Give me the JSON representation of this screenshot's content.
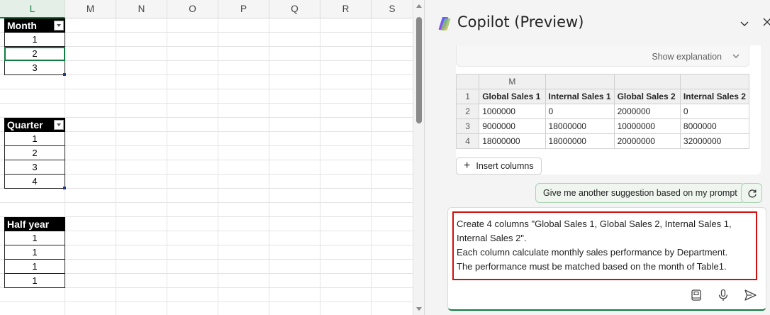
{
  "sheet": {
    "columns": [
      "L",
      "M",
      "N",
      "O",
      "P",
      "Q",
      "R",
      "S"
    ],
    "selected_column": "L",
    "tables": [
      {
        "header": "Month",
        "has_filter": true,
        "values": [
          "1",
          "2",
          "3"
        ]
      },
      {
        "header": "Quarter",
        "has_filter": true,
        "values": [
          "1",
          "2",
          "3",
          "4"
        ]
      },
      {
        "header": "Half year",
        "has_filter": false,
        "values": [
          "1",
          "1",
          "1",
          "1"
        ]
      }
    ]
  },
  "copilot": {
    "title": "Copilot (Preview)",
    "show_explanation": "Show explanation",
    "preview_table": {
      "column_letter": "M",
      "row_numbers": [
        "1",
        "2",
        "3",
        "4"
      ],
      "headers": [
        "Global Sales 1",
        "Internal Sales 1",
        "Global Sales 2",
        "Internal Sales 2"
      ],
      "rows": [
        [
          "1000000",
          "0",
          "2000000",
          "0"
        ],
        [
          "9000000",
          "18000000",
          "10000000",
          "8000000"
        ],
        [
          "18000000",
          "18000000",
          "20000000",
          "32000000"
        ]
      ]
    },
    "insert_columns": "Insert columns",
    "suggestion": "Give me another suggestion based on my prompt",
    "prompt": "Create 4 columns \"Global Sales 1, Global Sales 2, Internal Sales 1, Internal Sales 2\".\nEach column calculate monthly sales performance by Department.\nThe performance must be matched based on the month of Table1.",
    "accent_color": "#107c41",
    "highlight_color": "#d10f0f"
  }
}
